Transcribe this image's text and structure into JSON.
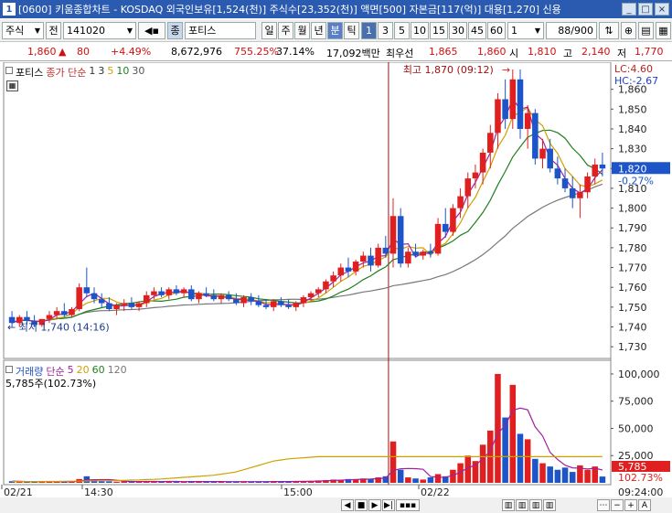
{
  "window": {
    "title": "[0600] 키움종합차트 - KOSDAQ 외국인보유[1,524(천)] 주식수[23,352(천)] 액면[500] 자본금[117(억)] 대용[1,270] 신용"
  },
  "toolbar": {
    "market": "주식",
    "period_mode": "전",
    "code": "141020",
    "stock_name": "포티스",
    "periods": [
      "일",
      "주",
      "월",
      "년",
      "분",
      "틱"
    ],
    "minute_options": [
      "1",
      "3",
      "5",
      "10",
      "15",
      "30",
      "45",
      "60"
    ],
    "unit_select": "1",
    "count": "88/900"
  },
  "quote": {
    "price": "1,860",
    "change": "80",
    "change_pct": "+4.49%",
    "volume": "8,672,976",
    "vol_ratio": "755.25%",
    "turnover": "37.14%",
    "amount": "17,092백만",
    "priority_label": "최우선",
    "ask": "1,865",
    "bid": "1,860",
    "open_label": "시",
    "open": "1,810",
    "high_label": "고",
    "high": "2,140",
    "low_label": "저",
    "low": "1,770"
  },
  "price_panel": {
    "name": "포티스",
    "ma_legend": {
      "label": "종가 단순",
      "periods": [
        "1",
        "3",
        "5",
        "10",
        "30"
      ]
    },
    "lc": "LC:4.60",
    "hc": "HC:-2.67",
    "max_annot": "최고 1,870 (09:12)",
    "min_annot": "최저 1,740 (14:16)",
    "current": "1,820",
    "current_pct": "-0.27%",
    "y_ticks": [
      "1,860",
      "1,850",
      "1,840",
      "1,830",
      "1,820",
      "1,810",
      "1,800",
      "1,790",
      "1,780",
      "1,770",
      "1,760",
      "1,750",
      "1,740",
      "1,730"
    ]
  },
  "volume_panel": {
    "name": "거래량",
    "ma_legend": {
      "label": "단순",
      "periods": [
        "5",
        "20",
        "60",
        "120"
      ]
    },
    "current_text": "5,785주(102.73%)",
    "y_ticks": [
      "100,000",
      "75,000",
      "50,000",
      "25,000"
    ],
    "last_vol": "5,785",
    "last_pct": "102.73%"
  },
  "time_axis": {
    "labels": [
      "02/21",
      "14:30",
      "15:00",
      "02/22",
      "09:24:00"
    ]
  },
  "chart_data": [
    {
      "type": "candlestick",
      "title": "포티스",
      "ylim": [
        1725,
        1870
      ],
      "candles": [
        [
          1745,
          1748,
          1740,
          1742
        ],
        [
          1742,
          1746,
          1740,
          1745
        ],
        [
          1745,
          1748,
          1741,
          1743
        ],
        [
          1743,
          1746,
          1740,
          1741
        ],
        [
          1741,
          1744,
          1740,
          1744
        ],
        [
          1744,
          1748,
          1742,
          1746
        ],
        [
          1746,
          1750,
          1744,
          1748
        ],
        [
          1748,
          1752,
          1745,
          1746
        ],
        [
          1746,
          1750,
          1745,
          1749
        ],
        [
          1749,
          1762,
          1748,
          1760
        ],
        [
          1760,
          1770,
          1755,
          1757
        ],
        [
          1757,
          1760,
          1752,
          1754
        ],
        [
          1754,
          1757,
          1750,
          1752
        ],
        [
          1752,
          1755,
          1748,
          1749
        ],
        [
          1749,
          1752,
          1746,
          1751
        ],
        [
          1751,
          1754,
          1748,
          1752
        ],
        [
          1752,
          1755,
          1749,
          1750
        ],
        [
          1750,
          1753,
          1748,
          1752
        ],
        [
          1752,
          1758,
          1750,
          1756
        ],
        [
          1756,
          1760,
          1754,
          1758
        ],
        [
          1758,
          1760,
          1755,
          1756
        ],
        [
          1756,
          1760,
          1754,
          1759
        ],
        [
          1759,
          1761,
          1756,
          1757
        ],
        [
          1757,
          1760,
          1755,
          1759
        ],
        [
          1759,
          1761,
          1753,
          1754
        ],
        [
          1754,
          1758,
          1752,
          1757
        ],
        [
          1757,
          1760,
          1755,
          1756
        ],
        [
          1756,
          1759,
          1753,
          1754
        ],
        [
          1754,
          1757,
          1752,
          1756
        ],
        [
          1756,
          1758,
          1753,
          1754
        ],
        [
          1754,
          1757,
          1751,
          1752
        ],
        [
          1752,
          1756,
          1750,
          1755
        ],
        [
          1755,
          1757,
          1751,
          1753
        ],
        [
          1753,
          1756,
          1750,
          1751
        ],
        [
          1751,
          1754,
          1749,
          1750
        ],
        [
          1750,
          1754,
          1748,
          1753
        ],
        [
          1753,
          1755,
          1750,
          1751
        ],
        [
          1751,
          1754,
          1749,
          1750
        ],
        [
          1750,
          1753,
          1748,
          1752
        ],
        [
          1752,
          1756,
          1750,
          1755
        ],
        [
          1755,
          1758,
          1753,
          1757
        ],
        [
          1757,
          1760,
          1755,
          1759
        ],
        [
          1759,
          1764,
          1757,
          1763
        ],
        [
          1763,
          1768,
          1760,
          1766
        ],
        [
          1766,
          1772,
          1763,
          1770
        ],
        [
          1770,
          1775,
          1765,
          1768
        ],
        [
          1768,
          1774,
          1766,
          1773
        ],
        [
          1773,
          1778,
          1770,
          1776
        ],
        [
          1776,
          1780,
          1768,
          1771
        ],
        [
          1771,
          1782,
          1770,
          1780
        ],
        [
          1780,
          1786,
          1775,
          1777
        ],
        [
          1777,
          1805,
          1770,
          1796
        ],
        [
          1796,
          1800,
          1770,
          1772
        ],
        [
          1772,
          1780,
          1770,
          1778
        ],
        [
          1778,
          1782,
          1775,
          1776
        ],
        [
          1776,
          1779,
          1774,
          1778
        ],
        [
          1778,
          1782,
          1775,
          1777
        ],
        [
          1777,
          1795,
          1776,
          1792
        ],
        [
          1792,
          1800,
          1785,
          1788
        ],
        [
          1788,
          1802,
          1786,
          1800
        ],
        [
          1800,
          1810,
          1795,
          1806
        ],
        [
          1806,
          1818,
          1800,
          1815
        ],
        [
          1815,
          1822,
          1810,
          1818
        ],
        [
          1818,
          1830,
          1812,
          1828
        ],
        [
          1828,
          1842,
          1820,
          1838
        ],
        [
          1838,
          1858,
          1830,
          1855
        ],
        [
          1855,
          1865,
          1840,
          1845
        ],
        [
          1845,
          1870,
          1840,
          1865
        ],
        [
          1865,
          1870,
          1835,
          1840
        ],
        [
          1840,
          1852,
          1830,
          1848
        ],
        [
          1848,
          1850,
          1822,
          1825
        ],
        [
          1825,
          1835,
          1820,
          1830
        ],
        [
          1830,
          1835,
          1818,
          1820
        ],
        [
          1820,
          1826,
          1812,
          1815
        ],
        [
          1815,
          1820,
          1808,
          1810
        ],
        [
          1810,
          1816,
          1800,
          1805
        ],
        [
          1805,
          1812,
          1795,
          1808
        ],
        [
          1808,
          1818,
          1805,
          1816
        ],
        [
          1816,
          1825,
          1812,
          1822
        ],
        [
          1822,
          1828,
          1816,
          1820
        ]
      ]
    },
    {
      "type": "bar",
      "title": "거래량",
      "ylim": [
        0,
        105000
      ],
      "values": [
        1500,
        1200,
        900,
        1100,
        800,
        1300,
        1000,
        900,
        1200,
        3500,
        6000,
        2500,
        1500,
        1300,
        1000,
        1200,
        900,
        1400,
        1600,
        1100,
        1000,
        1200,
        1300,
        900,
        1500,
        1100,
        1000,
        1200,
        900,
        1100,
        1300,
        1000,
        1200,
        900,
        1100,
        1500,
        1200,
        1300,
        1000,
        1600,
        1800,
        2200,
        2500,
        3000,
        2800,
        3500,
        3200,
        4000,
        3600,
        5000,
        6000,
        38000,
        12000,
        5000,
        4000,
        3000,
        5000,
        8000,
        6000,
        12000,
        18000,
        25000,
        20000,
        35000,
        48000,
        100000,
        60000,
        90000,
        45000,
        40000,
        22000,
        18000,
        15000,
        12000,
        14000,
        10000,
        16000,
        12000,
        15000,
        5785
      ],
      "ma_series": [
        {
          "name": "20",
          "values": [
            1200,
            1200,
            1200,
            1200,
            1200,
            1300,
            1300,
            1400,
            1500,
            1600,
            1700,
            1800,
            1900,
            2000,
            2100,
            2300,
            2500,
            2700,
            3000,
            3200,
            3500,
            4000,
            4500,
            5000,
            5500,
            6000,
            6500,
            7000,
            8000,
            9000,
            10000,
            12000,
            14000,
            16000,
            18000,
            20000,
            21000,
            22000,
            22500,
            23000,
            23500,
            24000,
            24000,
            24000,
            24000,
            24000,
            24000,
            24000,
            24000,
            24000,
            24000,
            24000,
            24000,
            24000,
            24000,
            24000,
            24000,
            24000,
            24000,
            24000,
            24000,
            24000,
            24000,
            24000,
            24000,
            24000,
            24000,
            24000,
            24000,
            24000,
            24000,
            24000,
            24000,
            24000,
            24000,
            24000,
            24000,
            24000,
            24000,
            24000
          ]
        }
      ]
    }
  ]
}
